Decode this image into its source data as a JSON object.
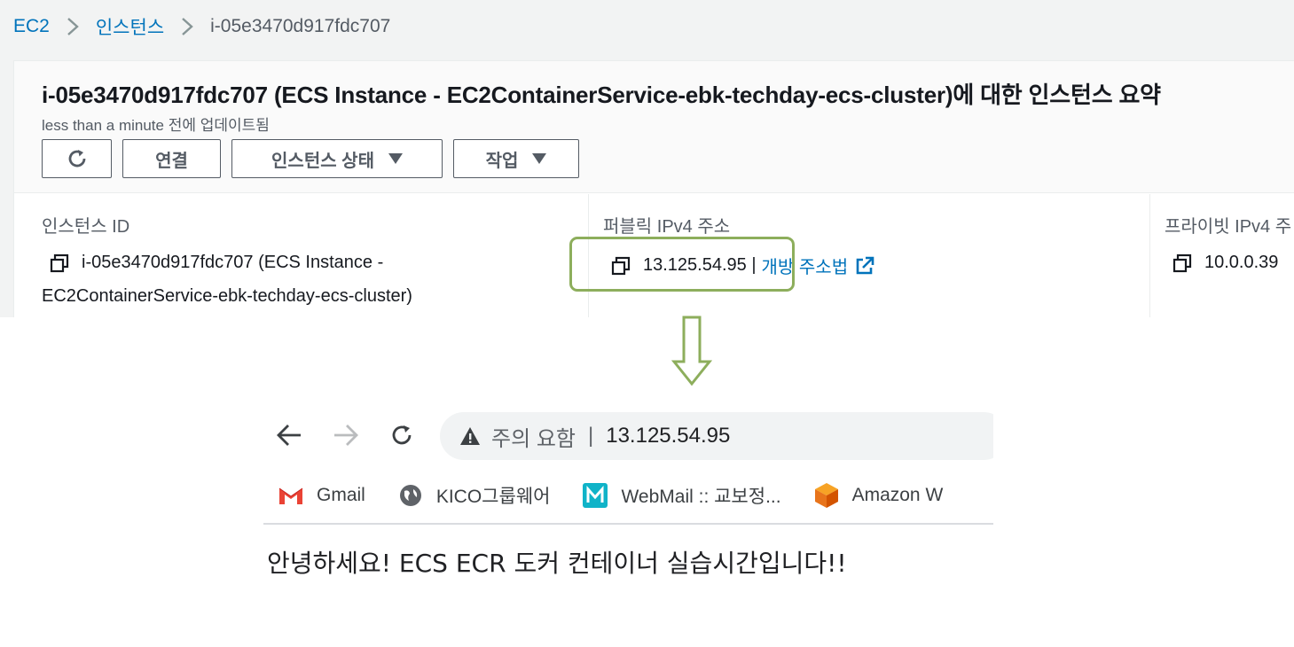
{
  "breadcrumb": {
    "items": [
      "EC2",
      "인스턴스",
      "i-05e3470d917fdc707"
    ]
  },
  "summary": {
    "title": "i-05e3470d917fdc707 (ECS Instance - EC2ContainerService-ebk-techday-ecs-cluster)에 대한 인스턴스 요약",
    "updated": "less than a minute 전에 업데이트됨",
    "buttons": {
      "connect": "연결",
      "instance_state": "인스턴스 상태",
      "actions": "작업"
    }
  },
  "details": {
    "instance_id": {
      "label": "인스턴스 ID",
      "value_line1": "i-05e3470d917fdc707 (ECS Instance -",
      "value_line2": "EC2ContainerService-ebk-techday-ecs-cluster)"
    },
    "public_ipv4": {
      "label": "퍼블릭 IPv4 주소",
      "value": "13.125.54.95 |",
      "link": "개방 주소법"
    },
    "private_ipv4": {
      "label": "프라이빗 IPv4 주",
      "value": "10.0.0.39"
    }
  },
  "browser": {
    "warning": "주의 요함",
    "separator": "|",
    "url": "13.125.54.95",
    "bookmarks": [
      {
        "label": "Gmail",
        "icon": "gmail-icon"
      },
      {
        "label": "KICO그룹웨어",
        "icon": "globe-icon"
      },
      {
        "label": "WebMail :: 교보정...",
        "icon": "webmail-icon"
      },
      {
        "label": "Amazon W",
        "icon": "amazon-cube-icon"
      }
    ],
    "page_text": "안녕하세요! ECS ECR 도커 컨테이너 실습시간입니다!!"
  },
  "colors": {
    "aws_link": "#0073bb",
    "highlight": "#8dae5c",
    "arrow": "#8dae5c"
  }
}
